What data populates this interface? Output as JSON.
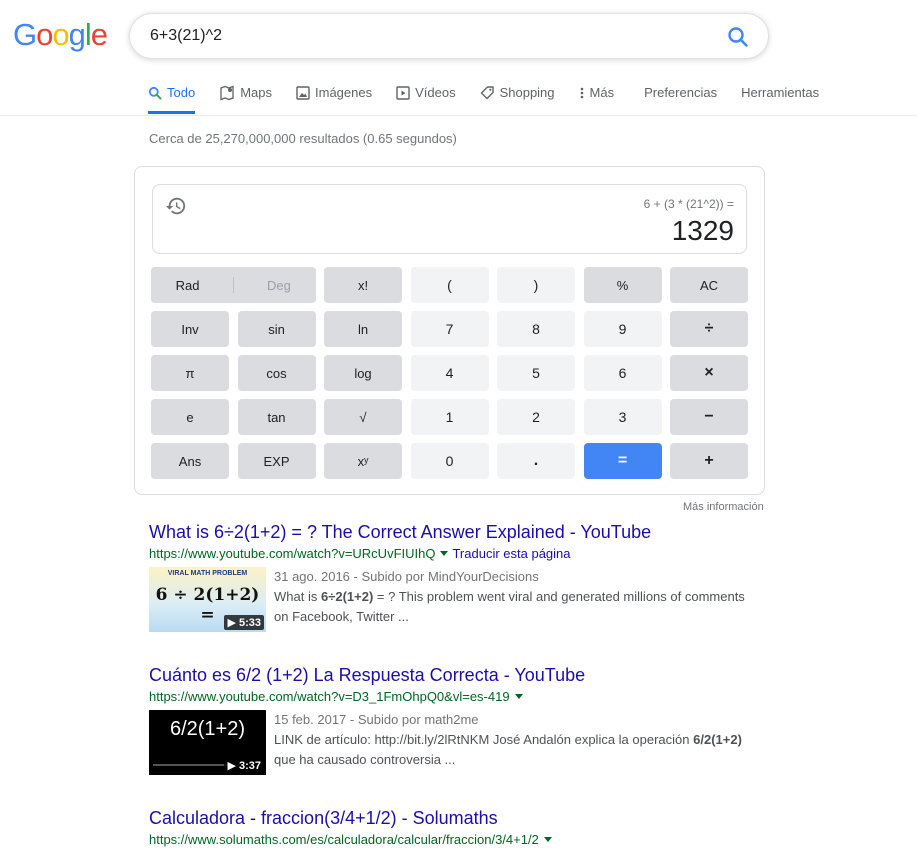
{
  "logo": {
    "letters": [
      "G",
      "o",
      "o",
      "g",
      "l",
      "e"
    ],
    "colors": [
      "#4285F4",
      "#EA4335",
      "#FBBC05",
      "#4285F4",
      "#34A853",
      "#EA4335"
    ]
  },
  "search": {
    "query": "6+3(21)^2",
    "icon": "search-icon"
  },
  "tabs": [
    {
      "label": "Todo",
      "icon": "search-icon",
      "active": true
    },
    {
      "label": "Maps",
      "icon": "map-icon"
    },
    {
      "label": "Imágenes",
      "icon": "image-icon"
    },
    {
      "label": "Vídeos",
      "icon": "video-icon"
    },
    {
      "label": "Shopping",
      "icon": "tag-icon"
    },
    {
      "label": "Más",
      "icon": "more-vert-icon"
    },
    {
      "label": "Preferencias"
    },
    {
      "label": "Herramientas"
    }
  ],
  "stats": "Cerca de 25,270,000,000 resultados (0.65 segundos)",
  "calculator": {
    "expression": "6 + (3 * (21^2)) =",
    "result": "1329",
    "rad_label": "Rad",
    "deg_label": "Deg",
    "keys": [
      "x!",
      "(",
      ")",
      "%",
      "AC",
      "Inv",
      "sin",
      "ln",
      "7",
      "8",
      "9",
      "÷",
      "π",
      "cos",
      "log",
      "4",
      "5",
      "6",
      "×",
      "e",
      "tan",
      "√",
      "1",
      "2",
      "3",
      "−",
      "Ans",
      "EXP",
      "xʸ",
      "0",
      ".",
      "=",
      "+"
    ],
    "more_info": "Más información"
  },
  "results": [
    {
      "title": "What is 6÷2(1+2) = ? The Correct Answer Explained - YouTube",
      "url": "https://www.youtube.com/watch?v=URcUvFIUIhQ",
      "translate": "Traducir esta página",
      "meta": "31 ago. 2016 - Subido por MindYourDecisions",
      "snippet_pre": "What is ",
      "snippet_bold": "6÷2(1+2)",
      "snippet_post": " = ? This problem went viral and generated millions of comments on Facebook, Twitter ...",
      "thumb_caption": "VIRAL MATH PROBLEM",
      "thumb_formula": "6 ÷ 2(1+2) =",
      "duration": "5:33"
    },
    {
      "title": "Cuánto es 6/2 (1+2) La Respuesta Correcta - YouTube",
      "url": "https://www.youtube.com/watch?v=D3_1FmOhpQ0&vl=es-419",
      "meta": "15 feb. 2017 - Subido por math2me",
      "snippet_pre": "LINK de artículo: http://bit.ly/2lRtNKM José Andalón explica la operación ",
      "snippet_bold": "6/2(1+2)",
      "snippet_post": " que ha causado controversia ...",
      "thumb_formula": "6/2(1+2)",
      "duration": "3:37"
    },
    {
      "title": "Calculadora - fraccion(3/4+1/2) - Solumaths",
      "url": "https://www.solumaths.com/es/calculadora/calcular/fraccion/3/4+1/2"
    }
  ]
}
